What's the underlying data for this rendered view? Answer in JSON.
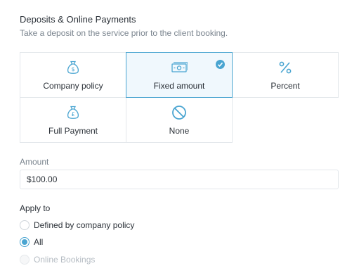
{
  "deposits": {
    "title": "Deposits & Online Payments",
    "description": "Take a deposit on the service prior to the client booking."
  },
  "options": [
    {
      "label": "Company policy",
      "icon": "money-bag-dollar-icon"
    },
    {
      "label": "Fixed amount",
      "icon": "banknote-icon",
      "selected": true
    },
    {
      "label": "Percent",
      "icon": "percent-icon"
    },
    {
      "label": "Full Payment",
      "icon": "money-bag-pound-icon"
    },
    {
      "label": "None",
      "icon": "prohibited-icon"
    }
  ],
  "amount": {
    "label": "Amount",
    "value": "$100.00"
  },
  "apply_to": {
    "label": "Apply to",
    "options": [
      {
        "label": "Defined by company policy",
        "checked": false,
        "disabled": false
      },
      {
        "label": "All",
        "checked": true,
        "disabled": false
      },
      {
        "label": "Online Bookings",
        "checked": false,
        "disabled": true
      }
    ]
  },
  "colors": {
    "accent": "#4aa5d1",
    "selected_bg": "#f0f8fd",
    "border": "#e3e7eb",
    "muted_text": "#7b858f"
  }
}
